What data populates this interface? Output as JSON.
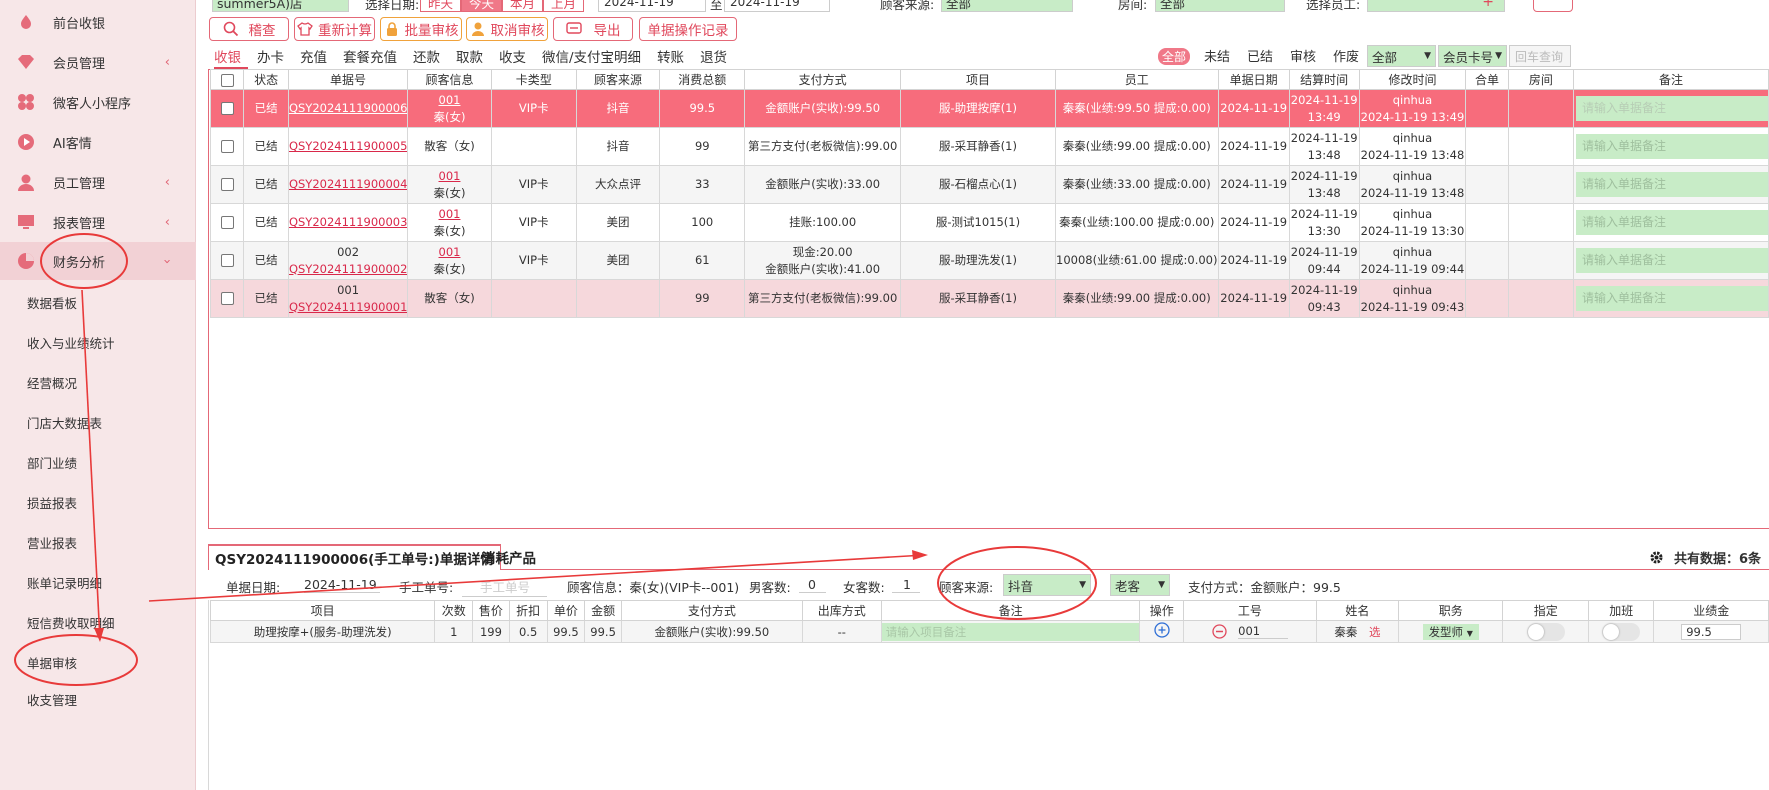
{
  "sidebar": {
    "menu": [
      {
        "label": "前台收银",
        "icon": "cash-register-icon"
      },
      {
        "label": "会员管理",
        "icon": "diamond-icon"
      },
      {
        "label": "微客人小程序",
        "icon": "miniprogram-icon"
      },
      {
        "label": "AI客情",
        "icon": "play-circle-icon"
      },
      {
        "label": "员工管理",
        "icon": "user-icon"
      },
      {
        "label": "报表管理",
        "icon": "monitor-icon"
      },
      {
        "label": "财务分析",
        "icon": "pie-chart-icon"
      }
    ],
    "submenu": [
      "数据看板",
      "收入与业绩统计",
      "经营概况",
      "门店大数据表",
      "部门业绩",
      "损益报表",
      "营业报表",
      "账单记录明细",
      "短信费收取明细",
      "单据审核",
      "收支管理"
    ]
  },
  "topbar": {
    "store": "summer5A)店",
    "date_label": "选择日期:",
    "date_btns": [
      "昨天",
      "今天",
      "本月",
      "上月"
    ],
    "date_from": "2024-11-19",
    "date_to_sep": "至",
    "date_to": "2024-11-19",
    "source_label": "顾客来源:",
    "source_value": "全部",
    "room_label": "房间:",
    "room_value": "全部",
    "staff_label": "选择员工:"
  },
  "actions": {
    "search": "稽查",
    "recalc": "重新计算",
    "batch_audit": "批量审核",
    "cancel_audit": "取消审核",
    "export": "导出",
    "ops_log": "单据操作记录"
  },
  "tabs": [
    "收银",
    "办卡",
    "充值",
    "套餐充值",
    "还款",
    "取款",
    "收支",
    "微信/支付宝明细",
    "转账",
    "退货"
  ],
  "filters": {
    "status": [
      "全部",
      "未结",
      "已结",
      "审核",
      "作废"
    ],
    "select1": "全部",
    "select2": "会员卡号",
    "hui_che": "回车查询"
  },
  "table": {
    "headers": [
      "",
      "状态",
      "单据号",
      "顾客信息",
      "卡类型",
      "顾客来源",
      "消费总额",
      "支付方式",
      "项目",
      "员工",
      "单据日期",
      "结算时间",
      "修改时间",
      "合单",
      "房间",
      "备注"
    ],
    "note_placeholder": "请输入单据备注",
    "rows": [
      {
        "status": "已结",
        "no_top": "",
        "no": "QSY2024111900006",
        "cust_top": "001",
        "cust": "秦(女)",
        "card": "VIP卡",
        "source": "抖音",
        "total": "99.5",
        "pay1": "金额账户(实收):99.50",
        "pay2": "",
        "item": "服-助理按摩(1)",
        "staff": "秦秦(业绩:99.50 提成:0.00)",
        "date": "2024-11-19",
        "settle1": "2024-11-19",
        "settle2": "13:49",
        "mod1": "qinhua",
        "mod2": "2024-11-19 13:49"
      },
      {
        "status": "已结",
        "no_top": "",
        "no": "QSY2024111900005",
        "cust_top": "",
        "cust": "散客（女)",
        "card": "",
        "source": "抖音",
        "total": "99",
        "pay1": "第三方支付(老板微信):99.00",
        "pay2": "",
        "item": "服-采耳静香(1)",
        "staff": "秦秦(业绩:99.00 提成:0.00)",
        "date": "2024-11-19",
        "settle1": "2024-11-19",
        "settle2": "13:48",
        "mod1": "qinhua",
        "mod2": "2024-11-19 13:48"
      },
      {
        "status": "已结",
        "no_top": "",
        "no": "QSY2024111900004",
        "cust_top": "001",
        "cust": "秦(女)",
        "card": "VIP卡",
        "source": "大众点评",
        "total": "33",
        "pay1": "金额账户(实收):33.00",
        "pay2": "",
        "item": "服-石榴点心(1)",
        "staff": "秦秦(业绩:33.00 提成:0.00)",
        "date": "2024-11-19",
        "settle1": "2024-11-19",
        "settle2": "13:48",
        "mod1": "qinhua",
        "mod2": "2024-11-19 13:48"
      },
      {
        "status": "已结",
        "no_top": "",
        "no": "QSY2024111900003",
        "cust_top": "001",
        "cust": "秦(女)",
        "card": "VIP卡",
        "source": "美团",
        "total": "100",
        "pay1": "挂账:100.00",
        "pay2": "",
        "item": "服-测试1015(1)",
        "staff": "秦秦(业绩:100.00 提成:0.00)",
        "date": "2024-11-19",
        "settle1": "2024-11-19",
        "settle2": "13:30",
        "mod1": "qinhua",
        "mod2": "2024-11-19 13:30"
      },
      {
        "status": "已结",
        "no_top": "002",
        "no": "QSY2024111900002",
        "cust_top": "001",
        "cust": "秦(女)",
        "card": "VIP卡",
        "source": "美团",
        "total": "61",
        "pay1": "现金:20.00",
        "pay2": "金额账户(实收):41.00",
        "item": "服-助理洗发(1)",
        "staff": "10008(业绩:61.00 提成:0.00)",
        "date": "2024-11-19",
        "settle1": "2024-11-19",
        "settle2": "09:44",
        "mod1": "qinhua",
        "mod2": "2024-11-19 09:44"
      },
      {
        "status": "已结",
        "no_top": "001",
        "no": "QSY2024111900001",
        "cust_top": "",
        "cust": "散客（女)",
        "card": "",
        "source": "",
        "total": "99",
        "pay1": "第三方支付(老板微信):99.00",
        "pay2": "",
        "item": "服-采耳静香(1)",
        "staff": "秦秦(业绩:99.00 提成:0.00)",
        "date": "2024-11-19",
        "settle1": "2024-11-19",
        "settle2": "09:43",
        "mod1": "qinhua",
        "mod2": "2024-11-19 09:43"
      }
    ]
  },
  "detail": {
    "tab1": "QSY2024111900006(手工单号:)单据详情",
    "tab2": "消耗产品",
    "total_label": "共有数据：6条",
    "date_label": "单据日期:",
    "date_value": "2024-11-19",
    "manual_label": "手工单号:",
    "manual_placeholder": "手工单号",
    "customer": "顾客信息：秦(女)(VIP卡--001)",
    "male_label": "男客数:",
    "male_value": "0",
    "female_label": "女客数:",
    "female_value": "1",
    "source_label": "顾客来源:",
    "source_value": "抖音",
    "old_new": "老客",
    "pay": "支付方式：金额账户：99.5",
    "headers": [
      "项目",
      "次数",
      "售价",
      "折扣",
      "单价",
      "金额",
      "支付方式",
      "出库方式",
      "备注",
      "操作",
      "工号",
      "姓名",
      "职务",
      "指定",
      "加班",
      "业绩金"
    ],
    "row": {
      "item": "助理按摩+(服务-助理洗发)",
      "times": "1",
      "price": "199",
      "discount": "0.5",
      "unit": "99.5",
      "amount": "99.5",
      "pay": "金额账户(实收):99.50",
      "out": "--",
      "note_placeholder": "请输入项目备注",
      "staff_no": "001",
      "name": "秦秦",
      "choose": "选",
      "role": "发型师",
      "perf": "99.5"
    }
  },
  "colors": {
    "accent": "#e0485c",
    "highlight_row": "#f76c7c",
    "pink_row": "#f6d8dc",
    "green_field": "#c8ecc7"
  }
}
